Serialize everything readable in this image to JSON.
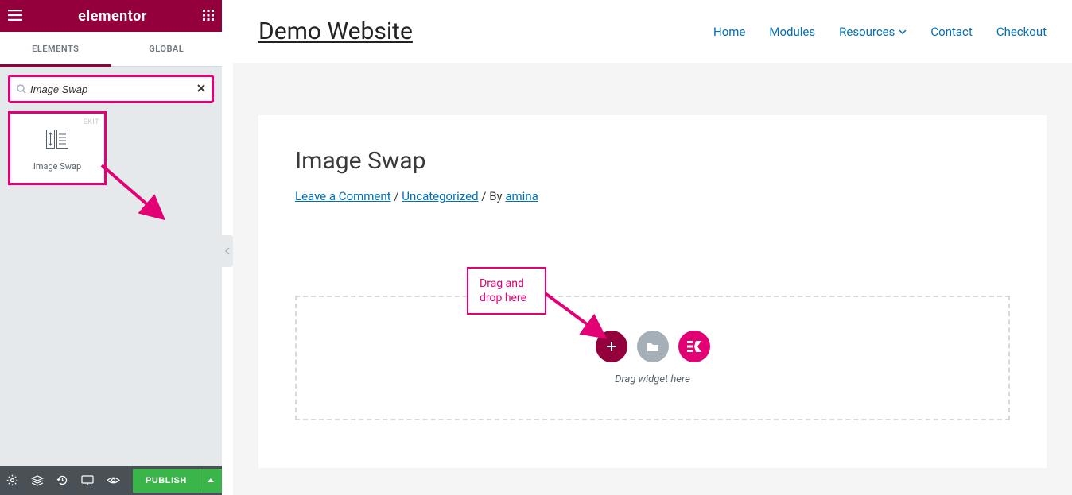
{
  "sidebar": {
    "brand": "elementor",
    "tabs": {
      "elements": "ELEMENTS",
      "global": "GLOBAL"
    },
    "search": {
      "value": "Image Swap",
      "clear_icon": "x"
    },
    "widget": {
      "badge": "EKIT",
      "label": "Image Swap"
    },
    "footer": {
      "publish": "PUBLISH"
    }
  },
  "preview": {
    "site_title": "Demo Website",
    "nav": {
      "home": "Home",
      "modules": "Modules",
      "resources": "Resources",
      "contact": "Contact",
      "checkout": "Checkout"
    },
    "page_title": "Image Swap",
    "meta": {
      "leave_comment": "Leave a Comment",
      "sep1": " / ",
      "category": "Uncategorized",
      "sep2": " / By ",
      "author": "amina"
    },
    "annotation": "Drag and drop here",
    "dropzone": {
      "hint": "Drag widget here",
      "ek_label": "Ξ"
    }
  }
}
